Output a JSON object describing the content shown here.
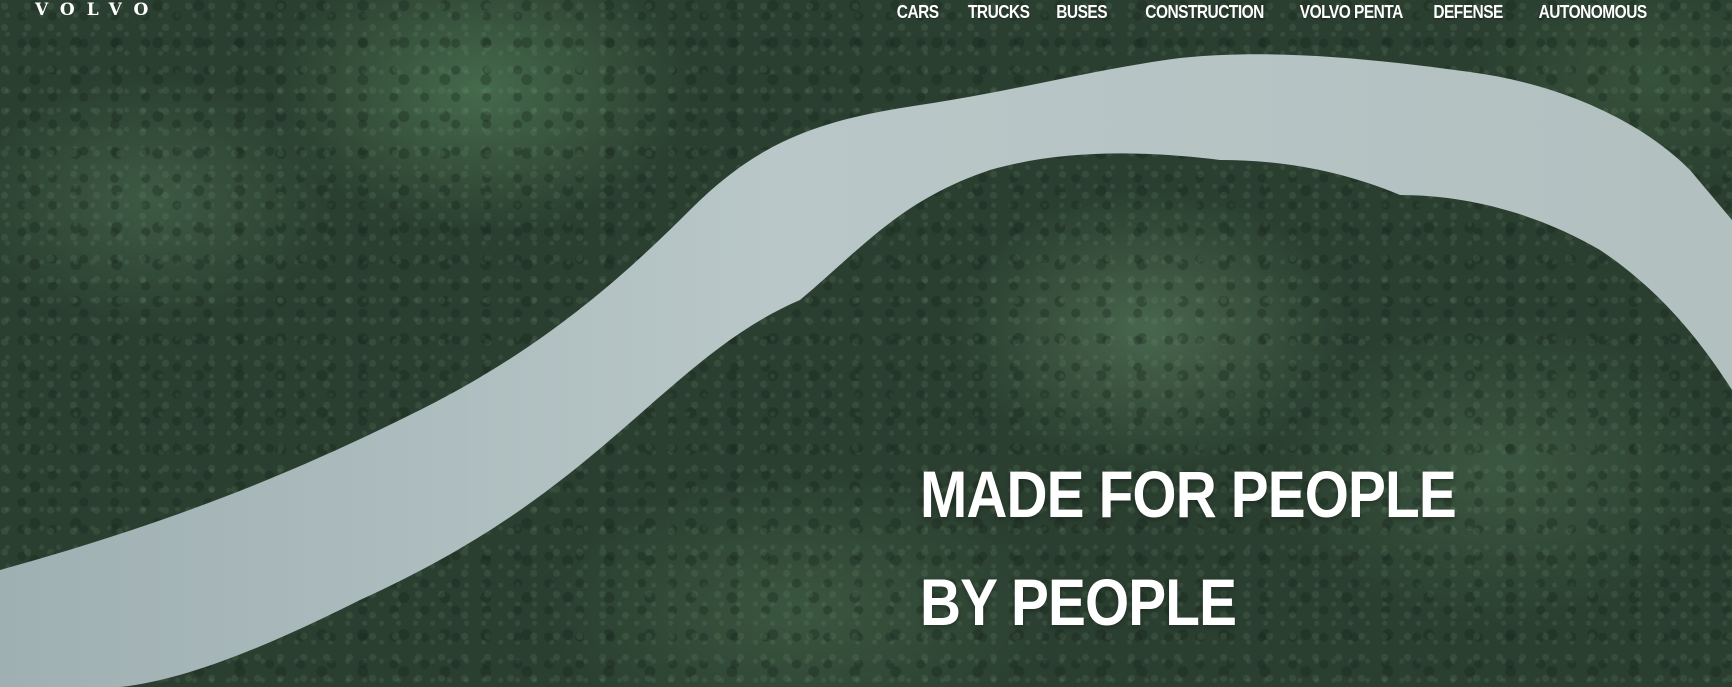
{
  "brand": {
    "logo_text": "VOLVO"
  },
  "nav": {
    "items": [
      {
        "label": "CARS"
      },
      {
        "label": "TRUCKS"
      },
      {
        "label": "BUSES"
      },
      {
        "label": "CONSTRUCTION"
      },
      {
        "label": "VOLVO PENTA"
      },
      {
        "label": "DEFENSE"
      },
      {
        "label": "AUTONOMOUS"
      }
    ]
  },
  "hero": {
    "headline_line1": "MADE FOR PEOPLE",
    "headline_line2": "BY PEOPLE",
    "background_image": "aerial-river-through-forest"
  },
  "colors": {
    "text": "#ffffff",
    "river": "#b7c4c4",
    "forest": "#2b3f30"
  }
}
